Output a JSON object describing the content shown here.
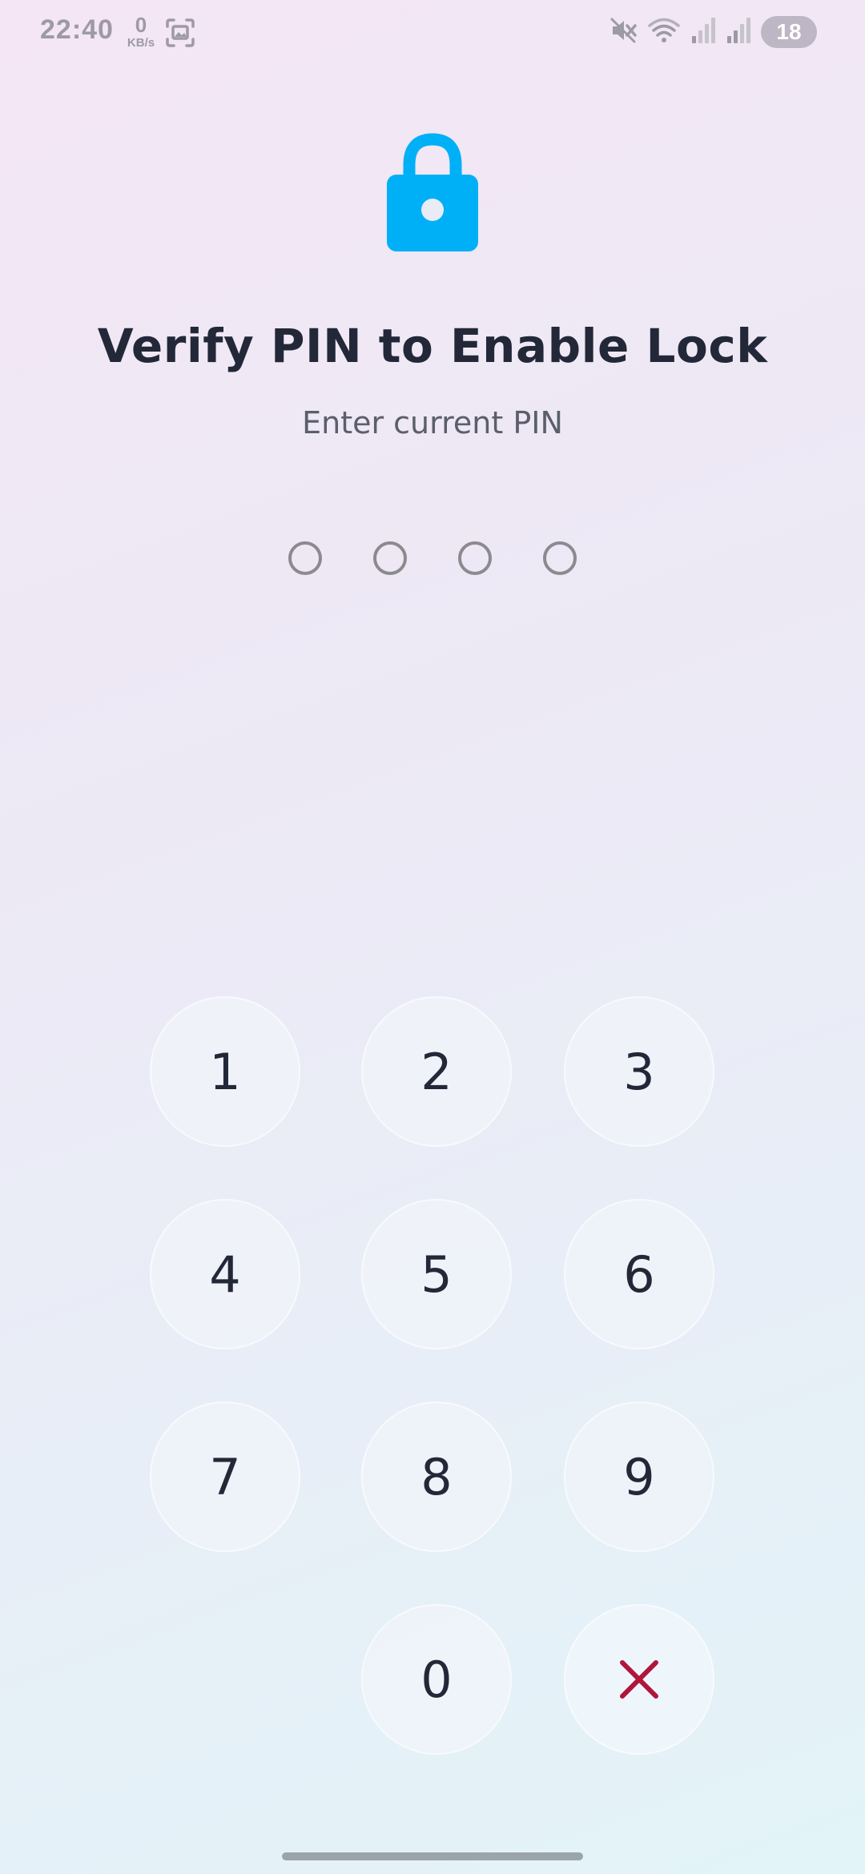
{
  "status_bar": {
    "time": "22:40",
    "network_speed_value": "0",
    "network_speed_unit": "KB/s",
    "battery_level": "18",
    "icons": [
      "screenshot-icon",
      "mute-icon",
      "wifi-icon",
      "signal-icon",
      "signal-icon"
    ]
  },
  "header": {
    "icon": "lock-icon",
    "title": "Verify PIN to Enable Lock",
    "subtitle": "Enter current PIN"
  },
  "pin": {
    "length": 4,
    "entered": 0
  },
  "keypad": {
    "keys": [
      "1",
      "2",
      "3",
      "4",
      "5",
      "6",
      "7",
      "8",
      "9",
      "0"
    ],
    "delete_icon": "close-icon"
  },
  "colors": {
    "accent": "#00b0f6",
    "delete": "#b0153b",
    "text": "#232838",
    "subtext": "#5b5f6c",
    "dot_border": "#8a8a8f"
  }
}
